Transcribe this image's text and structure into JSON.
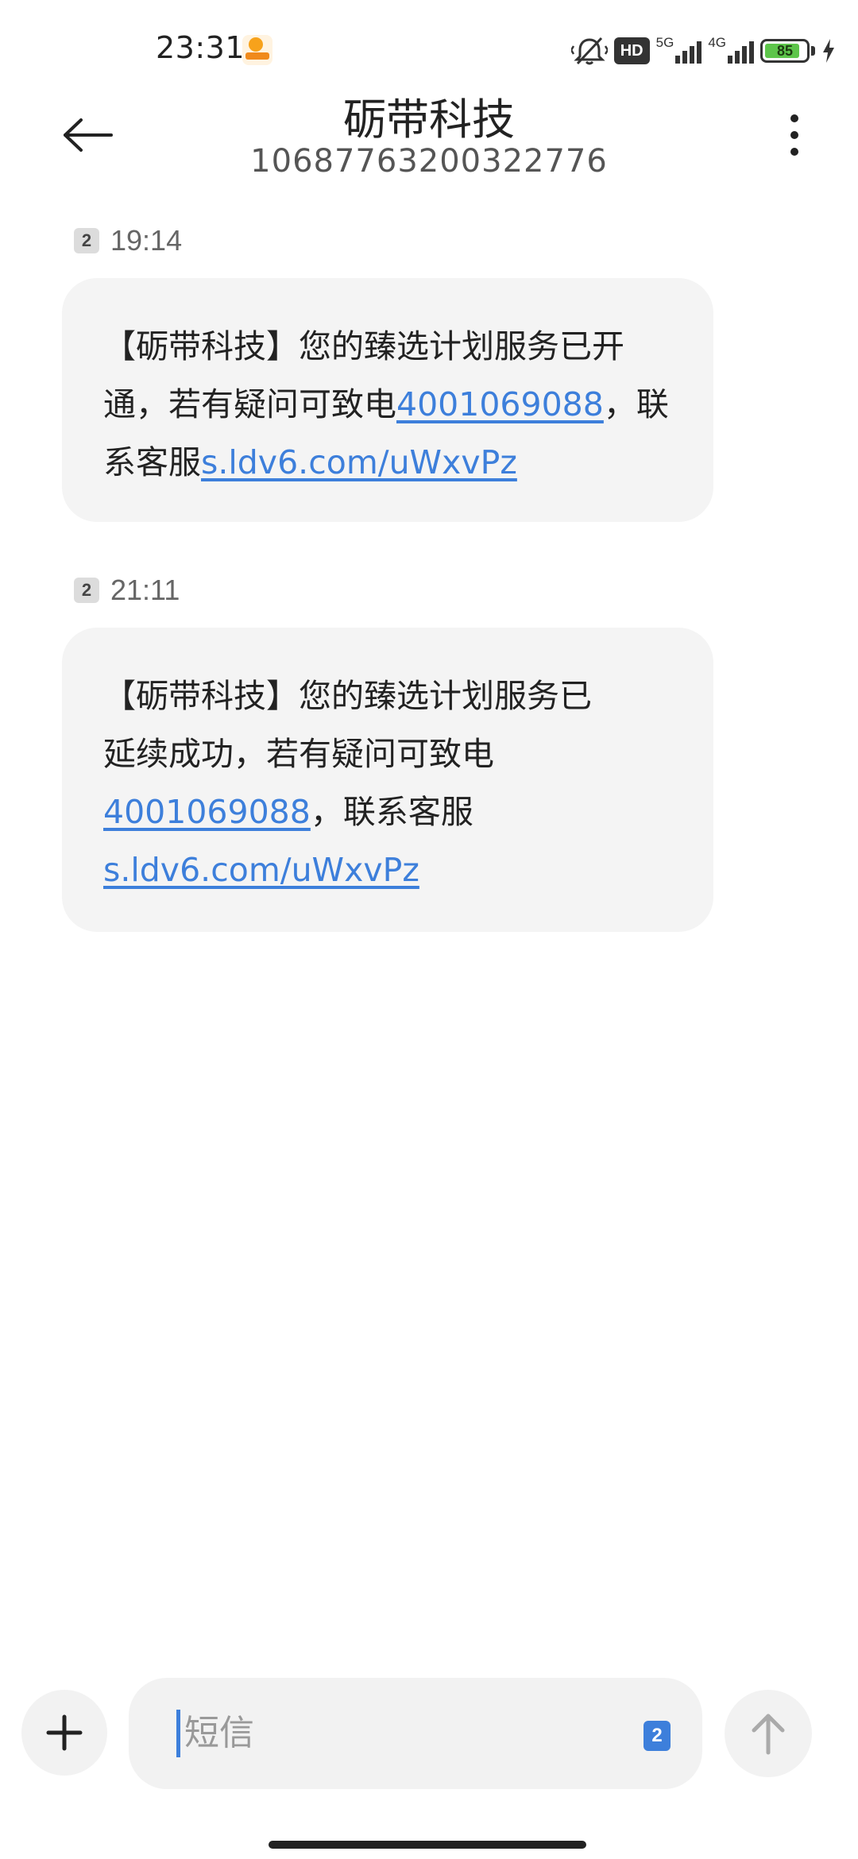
{
  "status_bar": {
    "time": "23:31",
    "hd_label": "HD",
    "network_1": "5G",
    "network_2": "4G",
    "battery_level": "85"
  },
  "header": {
    "contact_name": "砺带科技",
    "contact_number": "10687763200322776"
  },
  "messages": [
    {
      "sim": "2",
      "time": "19:14",
      "text_1": "【砺带科技】您的臻选计划服务已开通，若有疑问可致电",
      "phone": "4001069088",
      "text_2": "，联系客服",
      "url": "s.ldv6.com/uWxvPz"
    },
    {
      "sim": "2",
      "time": "21:11",
      "text_1": "【砺带科技】您的臻选计划服务已延续成功，若有疑问可致电",
      "phone": "4001069088",
      "text_2": "，联系客服",
      "url": "s.ldv6.com/uWxvPz"
    }
  ],
  "composer": {
    "placeholder": "短信",
    "sim": "2"
  },
  "colors": {
    "link": "#3d7fdb",
    "bubble": "#f4f4f4",
    "battery": "#5dc54a"
  }
}
